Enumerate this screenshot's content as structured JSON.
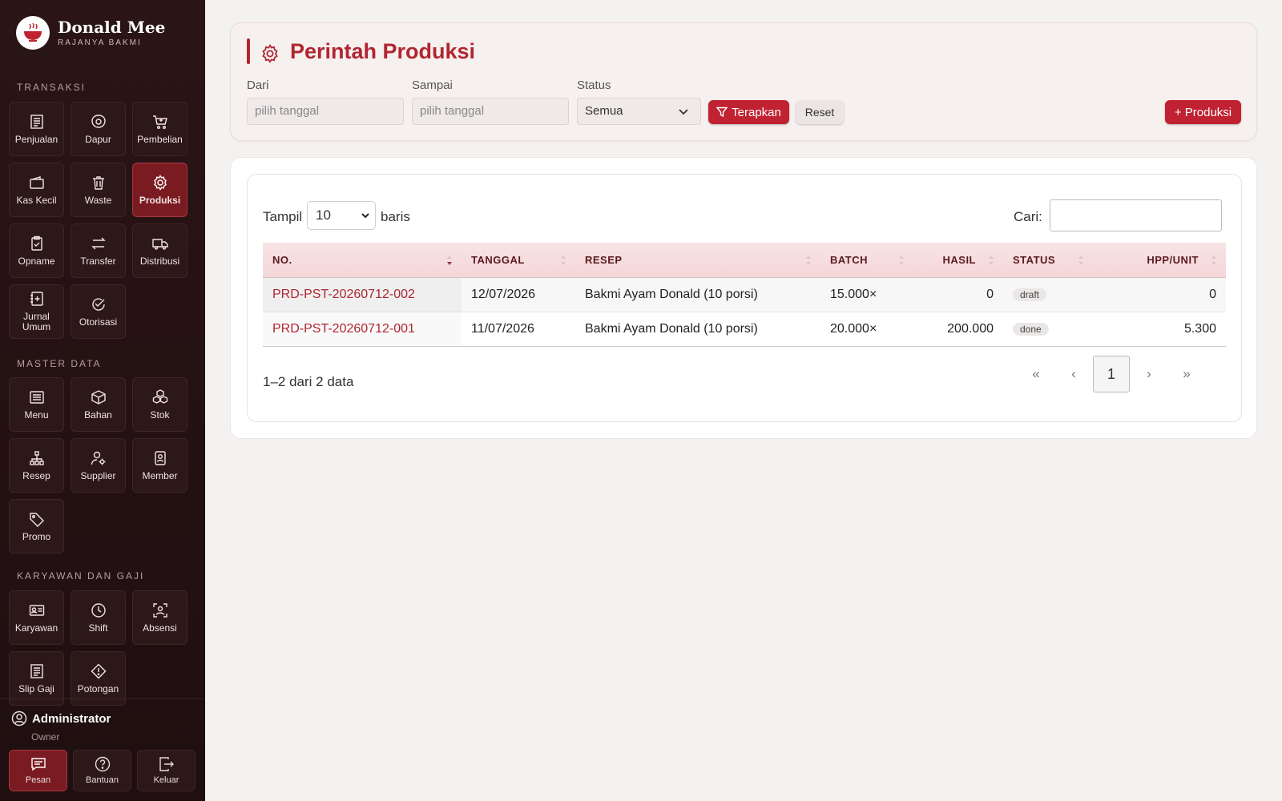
{
  "brand": {
    "name": "Donald Mee",
    "tagline": "RAJANYA BAKMI"
  },
  "sections": {
    "transaksi": "TRANSAKSI",
    "master": "MASTER DATA",
    "karyawan": "KARYAWAN DAN GAJI"
  },
  "nav": {
    "penjualan": "Penjualan",
    "dapur": "Dapur",
    "pembelian": "Pembelian",
    "kas_kecil": "Kas Kecil",
    "waste": "Waste",
    "produksi": "Produksi",
    "opname": "Opname",
    "transfer": "Transfer",
    "distribusi": "Distribusi",
    "jurnal_umum_1": "Jurnal",
    "jurnal_umum_2": "Umum",
    "otorisasi": "Otorisasi",
    "menu": "Menu",
    "bahan": "Bahan",
    "stok": "Stok",
    "resep": "Resep",
    "supplier": "Supplier",
    "member": "Member",
    "promo": "Promo",
    "karyawan": "Karyawan",
    "shift": "Shift",
    "absensi": "Absensi",
    "slip_gaji": "Slip Gaji",
    "potongan": "Potongan"
  },
  "user": {
    "name": "Administrator",
    "role": "Owner"
  },
  "bottom": {
    "pesan": "Pesan",
    "bantuan": "Bantuan",
    "keluar": "Keluar"
  },
  "page": {
    "title": "Perintah Produksi"
  },
  "filters": {
    "dari_label": "Dari",
    "dari_placeholder": "pilih tanggal",
    "sampai_label": "Sampai",
    "sampai_placeholder": "pilih tanggal",
    "status_label": "Status",
    "status_value": "Semua",
    "apply": "Terapkan",
    "reset": "Reset",
    "add": "+ Produksi"
  },
  "table_ctrl": {
    "show": "Tampil",
    "length": "10",
    "rows": "baris",
    "search": "Cari:",
    "info": "1–2 dari 2 data"
  },
  "table": {
    "headers": [
      "NO.",
      "TANGGAL",
      "RESEP",
      "BATCH",
      "HASIL",
      "STATUS",
      "HPP/UNIT"
    ],
    "rows": [
      {
        "no": "PRD-PST-20260712-002",
        "tanggal": "12/07/2026",
        "resep": "Bakmi Ayam Donald (10 porsi)",
        "batch": "15.000×",
        "hasil": "0",
        "status": "draft",
        "hpp": "0"
      },
      {
        "no": "PRD-PST-20260712-001",
        "tanggal": "11/07/2026",
        "resep": "Bakmi Ayam Donald (10 porsi)",
        "batch": "20.000×",
        "hasil": "200.000",
        "status": "done",
        "hpp": "5.300"
      }
    ]
  },
  "pagination": {
    "first": "«",
    "prev": "‹",
    "current": "1",
    "next": "›",
    "last": "»"
  },
  "colors": {
    "accent": "#b02631",
    "sidebar": "#2a1416",
    "active_tile": "#7a1b22"
  }
}
